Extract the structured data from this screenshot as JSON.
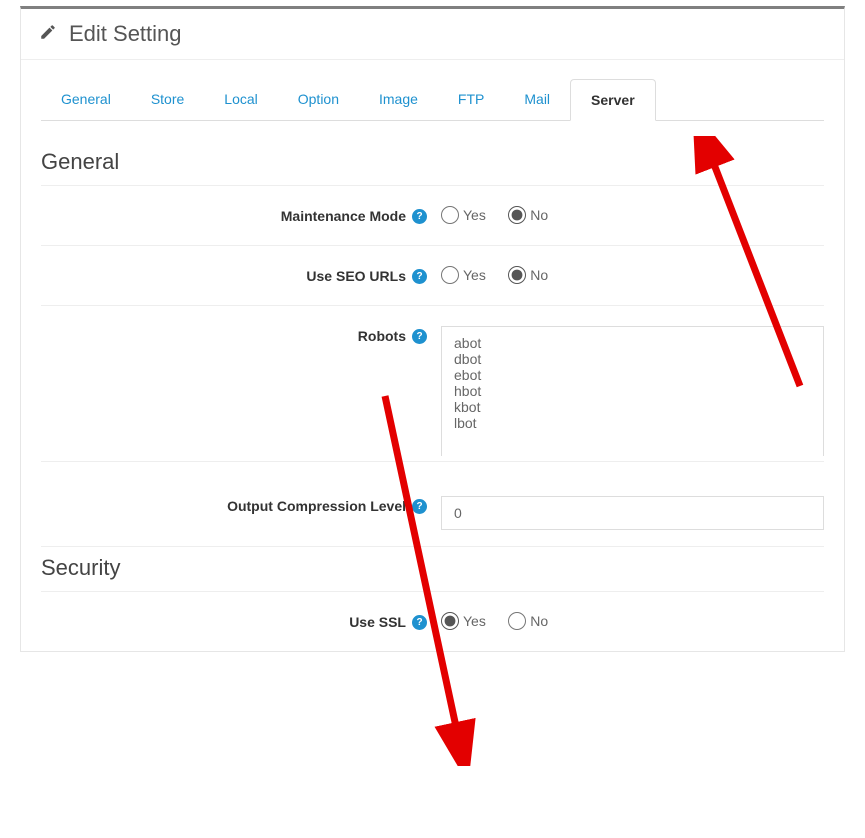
{
  "panel": {
    "title": "Edit Setting"
  },
  "tabs": [
    {
      "label": "General",
      "active": false
    },
    {
      "label": "Store",
      "active": false
    },
    {
      "label": "Local",
      "active": false
    },
    {
      "label": "Option",
      "active": false
    },
    {
      "label": "Image",
      "active": false
    },
    {
      "label": "FTP",
      "active": false
    },
    {
      "label": "Mail",
      "active": false
    },
    {
      "label": "Server",
      "active": true
    }
  ],
  "sections": {
    "general": {
      "title": "General"
    },
    "security": {
      "title": "Security"
    }
  },
  "fields": {
    "maintenance": {
      "label": "Maintenance Mode",
      "yes": "Yes",
      "no": "No",
      "value": "no"
    },
    "seo": {
      "label": "Use SEO URLs",
      "yes": "Yes",
      "no": "No",
      "value": "no"
    },
    "robots": {
      "label": "Robots",
      "value": "abot\ndbot\nebot\nhbot\nkbot\nlbot"
    },
    "compress": {
      "label": "Output Compression Level",
      "value": "0"
    },
    "ssl": {
      "label": "Use SSL",
      "yes": "Yes",
      "no": "No",
      "value": "yes"
    }
  },
  "help_glyph": "?"
}
